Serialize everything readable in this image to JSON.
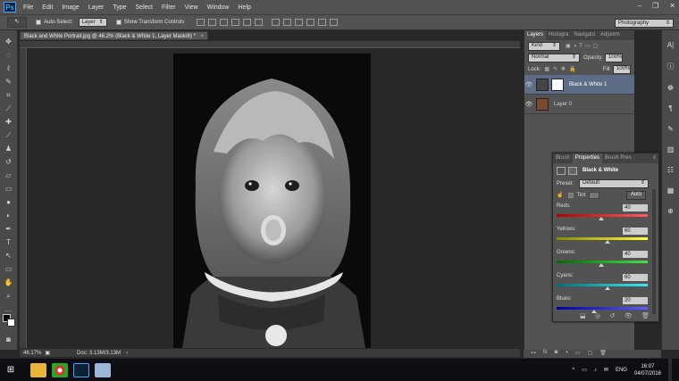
{
  "menubar": {
    "logo": "Ps",
    "items": [
      "File",
      "Edit",
      "Image",
      "Layer",
      "Type",
      "Select",
      "Filter",
      "View",
      "Window",
      "Help"
    ],
    "window_controls": [
      "–",
      "❐",
      "✕"
    ]
  },
  "options": {
    "tool_glyph": "↖",
    "auto_select": "Auto-Select:",
    "auto_select_target": "Layer",
    "show_transform": "Show Transform Controls",
    "workspace": "Photography"
  },
  "document": {
    "tab_title": "Black and White Portrait.jpg @ 46.2% (Black & White 1, Layer Mask/8) *",
    "tab_close": "×",
    "zoom": "46.17%",
    "doc_info": "Doc: 3.13M/3.13M"
  },
  "layers_panel": {
    "tabs": [
      "Layers",
      "Histogra",
      "Navigato",
      "Adjustm"
    ],
    "kind": "Kind",
    "blend_mode": "Normal",
    "opacity_label": "Opacity:",
    "opacity": "100%",
    "lock_label": "Lock:",
    "fill_label": "Fill:",
    "fill": "100%",
    "layers": [
      {
        "name": "Black & White 1",
        "selected": true
      },
      {
        "name": "Layer 0",
        "selected": false
      }
    ]
  },
  "properties_panel": {
    "tabs": [
      "Brush",
      "Properties",
      "Brush Pres"
    ],
    "title": "Black & White",
    "preset_label": "Preset:",
    "preset": "Default",
    "tint_label": "Tint",
    "auto_label": "Auto",
    "sliders": [
      {
        "label": "Reds:",
        "value": "40",
        "level": 0.48,
        "from": "#b00000",
        "to": "#ff5a5a"
      },
      {
        "label": "Yellows:",
        "value": "60",
        "level": 0.55,
        "from": "#8a8a00",
        "to": "#ffff3a"
      },
      {
        "label": "Greens:",
        "value": "40",
        "level": 0.48,
        "from": "#006b00",
        "to": "#47e047"
      },
      {
        "label": "Cyans:",
        "value": "60",
        "level": 0.55,
        "from": "#006f7a",
        "to": "#3ee6f5"
      },
      {
        "label": "Blues:",
        "value": "20",
        "level": 0.4,
        "from": "#0000a0",
        "to": "#5a5aff"
      }
    ]
  },
  "taskbar": {
    "start": "⊞",
    "lang": "ENG",
    "time": "16:07",
    "date": "04/07/2016",
    "tray_icons": [
      "^",
      "▭",
      "♪",
      "✉"
    ]
  },
  "colors": {
    "selected_layer": "#5d6d87",
    "app_bg": "#282828"
  }
}
